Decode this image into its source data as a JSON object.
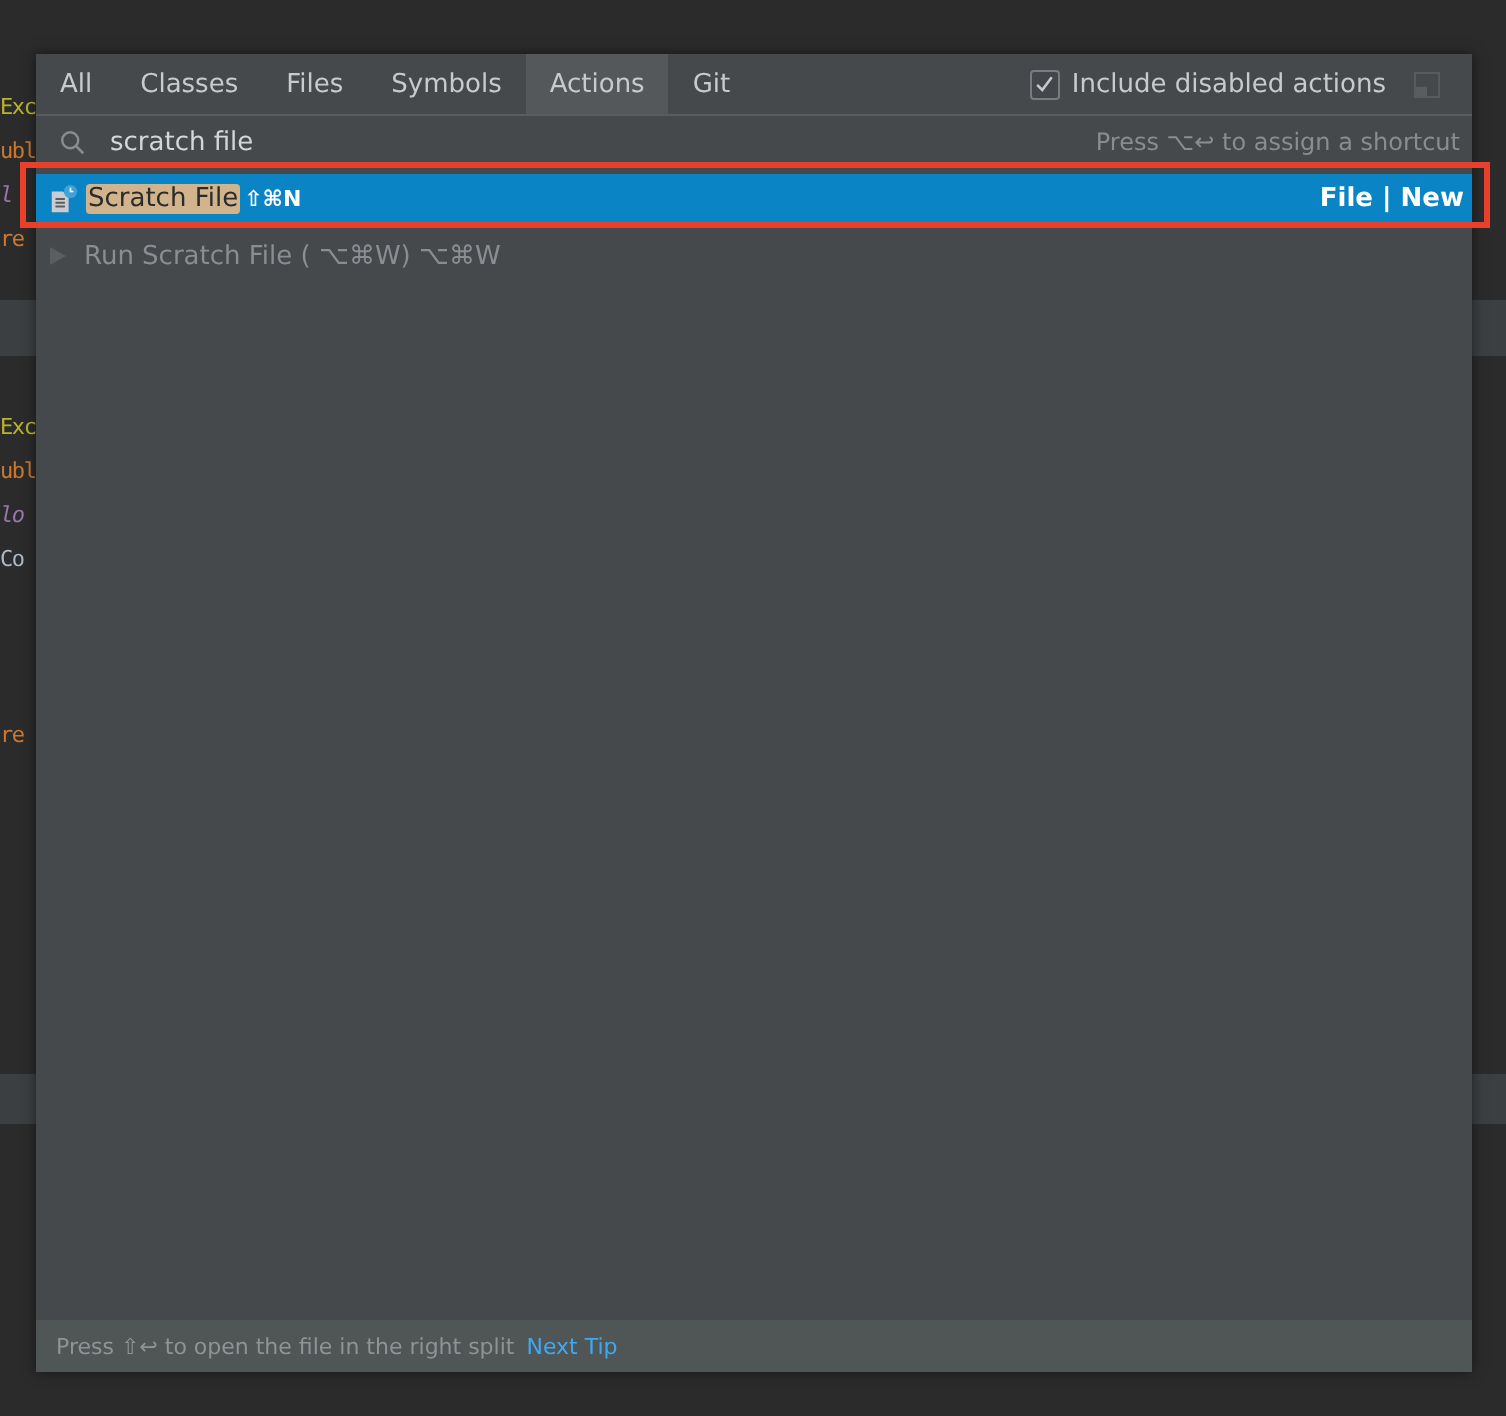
{
  "editor": {
    "blocks": [
      {
        "lines": [
          {
            "kind": "annotation",
            "text": "Exc"
          },
          {
            "kind": "keyword",
            "text": "ubl"
          },
          {
            "kind": "field",
            "text": "l"
          },
          {
            "kind": "keyword",
            "text": "re"
          }
        ]
      },
      {
        "lines": [
          {
            "kind": "annotation",
            "text": "Exc"
          },
          {
            "kind": "keyword",
            "text": "ubl"
          },
          {
            "kind": "field",
            "text": "lo"
          },
          {
            "kind": "plain",
            "text": "Co"
          },
          {
            "kind": "blank"
          },
          {
            "kind": "blank"
          },
          {
            "kind": "blank"
          },
          {
            "kind": "keyword",
            "text": "re"
          }
        ]
      }
    ]
  },
  "popup": {
    "tabs": [
      {
        "label": "All",
        "selected": false
      },
      {
        "label": "Classes",
        "selected": false
      },
      {
        "label": "Files",
        "selected": false
      },
      {
        "label": "Symbols",
        "selected": false
      },
      {
        "label": "Actions",
        "selected": true
      },
      {
        "label": "Git",
        "selected": false
      }
    ],
    "include_disabled": {
      "label": "Include disabled actions",
      "checked": true
    },
    "search": {
      "value": "scratch file",
      "hint": "Press ⌥↩ to assign a shortcut"
    },
    "results": [
      {
        "kind": "action",
        "match": "Scratch File",
        "shortcut": "⇧⌘N",
        "location": "File | New",
        "selected": true,
        "disabled": false
      },
      {
        "kind": "action",
        "label": "Run Scratch File ( ⌥⌘W) ⌥⌘W",
        "selected": false,
        "disabled": true
      }
    ],
    "footer": {
      "text": "Press ⇧↩ to open the file in the right split",
      "link": "Next Tip"
    }
  }
}
